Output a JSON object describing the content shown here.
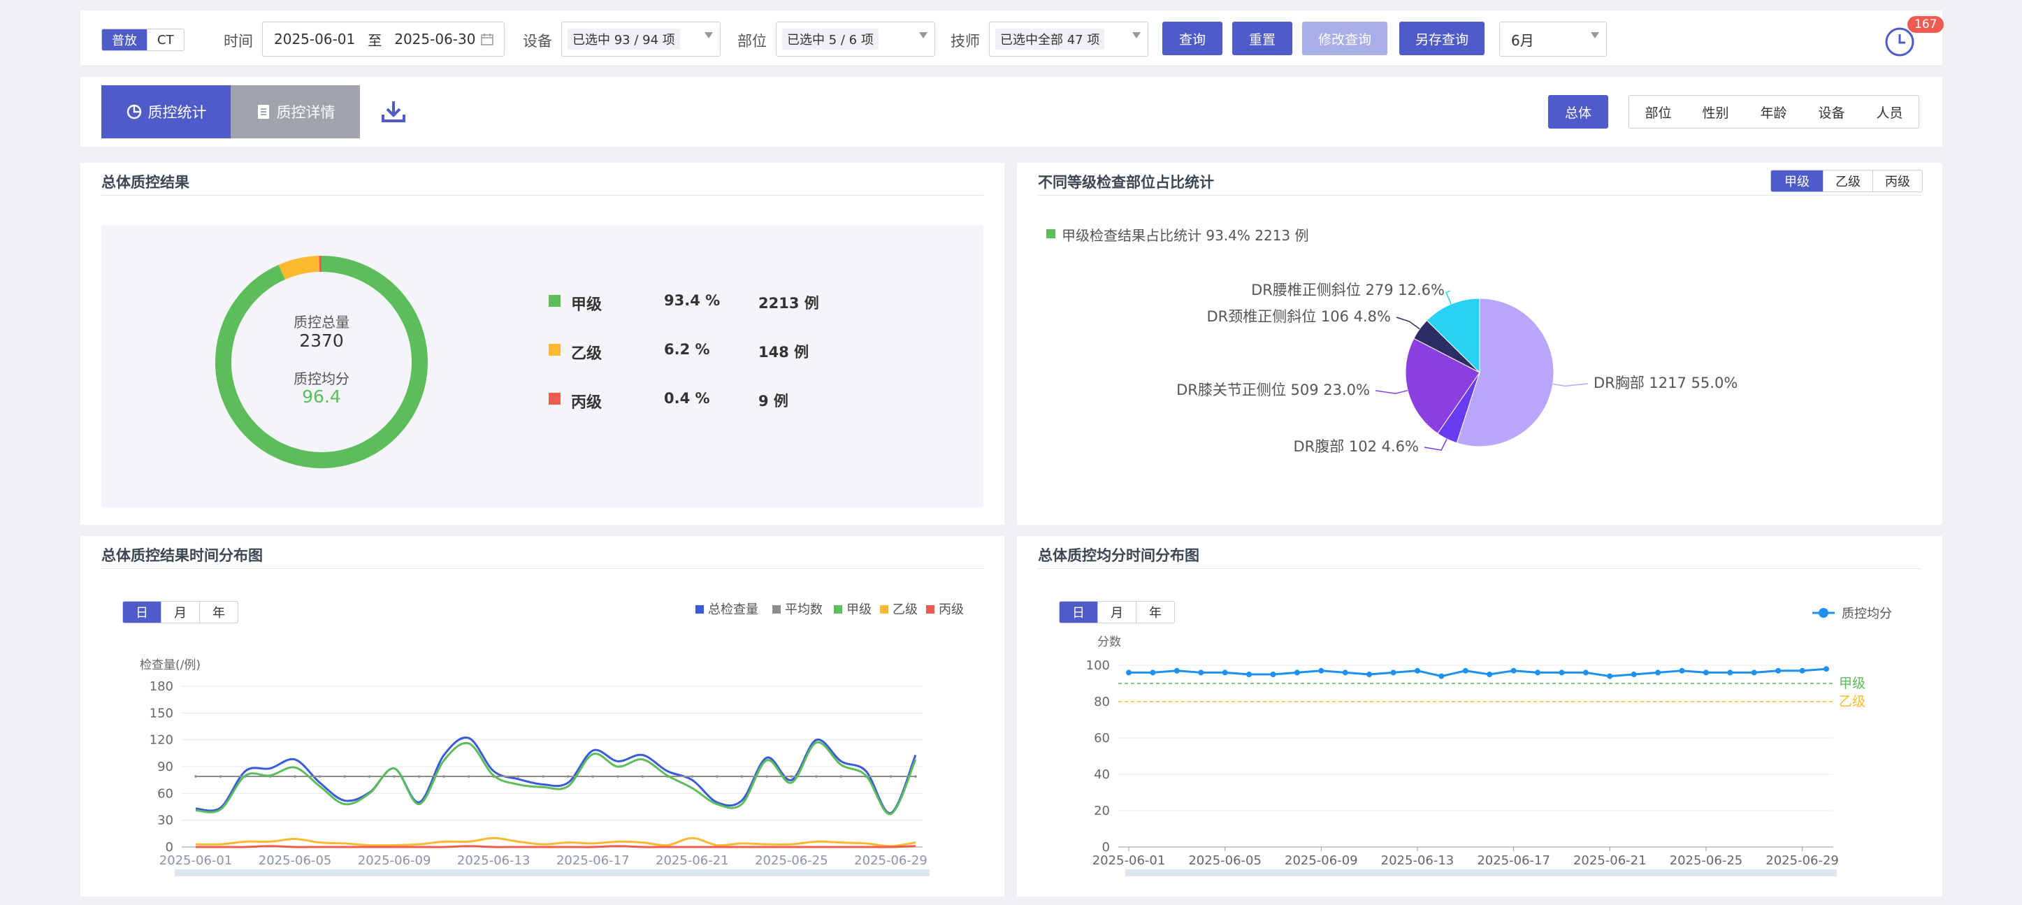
{
  "toolbar": {
    "modality": [
      "普放",
      "CT"
    ],
    "time_label": "时间",
    "date_start": "2025-06-01",
    "date_sep": "至",
    "date_end": "2025-06-30",
    "device_label": "设备",
    "device_value": "已选中 93 / 94 项",
    "part_label": "部位",
    "part_value": "已选中 5 / 6 项",
    "tech_label": "技师",
    "tech_value": "已选中全部 47 项",
    "query": "查询",
    "reset": "重置",
    "modify": "修改查询",
    "save_as": "另存查询",
    "month_select": "6月",
    "notify_count": "167"
  },
  "tabs": {
    "stats": "质控统计",
    "details": "质控详情",
    "dims": [
      "总体",
      "部位",
      "性别",
      "年龄",
      "设备",
      "人员"
    ]
  },
  "overall": {
    "title": "总体质控结果",
    "total_label": "质控总量",
    "total": "2370",
    "avg_label": "质控均分",
    "avg": "96.4",
    "rows": [
      {
        "name": "甲级",
        "pct": "93.4 %",
        "count": "2213 例",
        "color": "#5cbd5a"
      },
      {
        "name": "乙级",
        "pct": "6.2 %",
        "count": "148 例",
        "color": "#fbb931"
      },
      {
        "name": "丙级",
        "pct": "0.4 %",
        "count": "9 例",
        "color": "#f05b4f"
      }
    ]
  },
  "grade_pie": {
    "title": "不同等级检查部位占比统计",
    "grade_tabs": [
      "甲级",
      "乙级",
      "丙级"
    ],
    "legend": "甲级检查结果占比统计 93.4% 2213 例",
    "labels": [
      "DR胸部  1217  55.0%",
      "DR腹部  102  4.6%",
      "DR膝关节正侧位  509  23.0%",
      "DR颈椎正侧斜位  106  4.8%",
      "DR腰椎正侧斜位  279  12.6%"
    ]
  },
  "time_dist": {
    "title": "总体质控结果时间分布图",
    "period_tabs": [
      "日",
      "月",
      "年"
    ],
    "ylabel": "检查量(/例)",
    "legend": [
      "总检查量",
      "平均数",
      "甲级",
      "乙级",
      "丙级"
    ]
  },
  "score_dist": {
    "title": "总体质控均分时间分布图",
    "period_tabs": [
      "日",
      "月",
      "年"
    ],
    "ylabel": "分数",
    "legend": "质控均分",
    "mark_a": "甲级",
    "mark_b": "乙级"
  },
  "chart_data": [
    {
      "type": "pie",
      "title": "总体质控结果",
      "categories": [
        "甲级",
        "乙级",
        "丙级"
      ],
      "values": [
        2213,
        148,
        9
      ],
      "colors": [
        "#5cbd5a",
        "#fbb931",
        "#f05b4f"
      ]
    },
    {
      "type": "pie",
      "title": "不同等级检查部位占比统计",
      "categories": [
        "DR胸部",
        "DR腹部",
        "DR膝关节正侧位",
        "DR颈椎正侧斜位",
        "DR腰椎正侧斜位"
      ],
      "values": [
        1217,
        102,
        509,
        106,
        279
      ],
      "colors": [
        "#b9a7fb",
        "#6a3cf0",
        "#8c3fe0",
        "#2d2d63",
        "#28d2f5"
      ]
    },
    {
      "type": "line",
      "title": "总体质控结果时间分布图",
      "x": [
        "2025-06-01",
        "2025-06-02",
        "2025-06-03",
        "2025-06-04",
        "2025-06-05",
        "2025-06-06",
        "2025-06-07",
        "2025-06-08",
        "2025-06-09",
        "2025-06-10",
        "2025-06-11",
        "2025-06-12",
        "2025-06-13",
        "2025-06-14",
        "2025-06-15",
        "2025-06-16",
        "2025-06-17",
        "2025-06-18",
        "2025-06-19",
        "2025-06-20",
        "2025-06-21",
        "2025-06-22",
        "2025-06-23",
        "2025-06-24",
        "2025-06-25",
        "2025-06-26",
        "2025-06-27",
        "2025-06-28",
        "2025-06-29",
        "2025-06-30"
      ],
      "xticks": [
        "2025-06-01",
        "2025-06-05",
        "2025-06-09",
        "2025-06-13",
        "2025-06-17",
        "2025-06-21",
        "2025-06-25",
        "2025-06-29"
      ],
      "ylabel": "检查量(/例)",
      "ylim": [
        0,
        180
      ],
      "yticks": [
        0,
        30,
        60,
        90,
        120,
        150,
        180
      ],
      "series": [
        {
          "name": "总检查量",
          "color": "#3a5bd9",
          "values": [
            43,
            44,
            85,
            88,
            98,
            72,
            52,
            61,
            88,
            50,
            103,
            122,
            85,
            76,
            70,
            72,
            108,
            96,
            103,
            85,
            75,
            50,
            52,
            100,
            75,
            120,
            96,
            85,
            38,
            103
          ]
        },
        {
          "name": "平均数",
          "color": "#8c8c8c",
          "values": [
            79,
            79,
            79,
            79,
            79,
            79,
            79,
            79,
            79,
            79,
            79,
            79,
            79,
            79,
            79,
            79,
            79,
            79,
            79,
            79,
            79,
            79,
            79,
            79,
            79,
            79,
            79,
            79,
            79,
            79
          ]
        },
        {
          "name": "甲级",
          "color": "#5cbd5a",
          "values": [
            41,
            42,
            80,
            80,
            89,
            68,
            48,
            60,
            88,
            48,
            97,
            116,
            80,
            70,
            67,
            68,
            104,
            90,
            98,
            80,
            66,
            48,
            48,
            97,
            72,
            117,
            92,
            80,
            37,
            98
          ]
        },
        {
          "name": "乙级",
          "color": "#fbb931",
          "values": [
            3,
            3,
            6,
            6,
            9,
            5,
            4,
            2,
            2,
            3,
            6,
            6,
            10,
            6,
            3,
            5,
            4,
            6,
            5,
            2,
            10,
            2,
            4,
            3,
            3,
            6,
            5,
            4,
            1,
            5
          ]
        },
        {
          "name": "丙级",
          "color": "#f05b4f",
          "values": [
            0,
            0,
            0,
            1,
            0,
            0,
            0,
            0,
            0,
            0,
            0,
            1,
            0,
            0,
            0,
            0,
            0,
            1,
            0,
            0,
            0,
            0,
            0,
            0,
            0,
            0,
            0,
            0,
            0,
            1
          ]
        }
      ]
    },
    {
      "type": "line",
      "title": "总体质控均分时间分布图",
      "x": [
        "2025-06-01",
        "2025-06-02",
        "2025-06-03",
        "2025-06-04",
        "2025-06-05",
        "2025-06-06",
        "2025-06-07",
        "2025-06-08",
        "2025-06-09",
        "2025-06-10",
        "2025-06-11",
        "2025-06-12",
        "2025-06-13",
        "2025-06-14",
        "2025-06-15",
        "2025-06-16",
        "2025-06-17",
        "2025-06-18",
        "2025-06-19",
        "2025-06-20",
        "2025-06-21",
        "2025-06-22",
        "2025-06-23",
        "2025-06-24",
        "2025-06-25",
        "2025-06-26",
        "2025-06-27",
        "2025-06-28",
        "2025-06-29",
        "2025-06-30"
      ],
      "xticks": [
        "2025-06-01",
        "2025-06-05",
        "2025-06-09",
        "2025-06-13",
        "2025-06-17",
        "2025-06-21",
        "2025-06-25",
        "2025-06-29"
      ],
      "ylabel": "分数",
      "ylim": [
        0,
        100
      ],
      "yticks": [
        0,
        20,
        40,
        60,
        80,
        100
      ],
      "series": [
        {
          "name": "质控均分",
          "color": "#1e90f0",
          "values": [
            96,
            96,
            97,
            96,
            96,
            95,
            95,
            96,
            97,
            96,
            95,
            96,
            97,
            94,
            97,
            95,
            97,
            96,
            96,
            96,
            94,
            95,
            96,
            97,
            96,
            96,
            96,
            97,
            97,
            98
          ]
        }
      ],
      "reference_lines": [
        {
          "name": "甲级",
          "value": 90,
          "color": "#5cbd5a"
        },
        {
          "name": "乙级",
          "value": 80,
          "color": "#fbb931"
        }
      ]
    }
  ]
}
